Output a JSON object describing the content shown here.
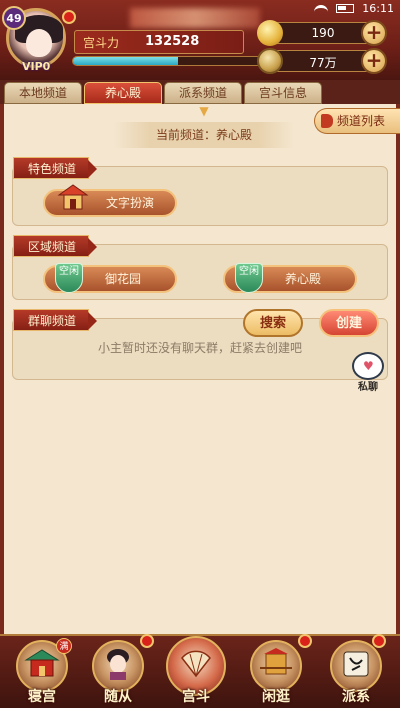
{
  "status_bar": {
    "time": "16:11"
  },
  "player": {
    "level": "49",
    "vip": "VIP0",
    "power_label": "宫斗力",
    "power_value": "132528",
    "exp_fraction": 0.56
  },
  "currencies": [
    {
      "icon": "gold-ingot-icon",
      "value": "190"
    },
    {
      "icon": "copper-coin-icon",
      "value": "77万"
    }
  ],
  "tabs": [
    {
      "label": "本地频道",
      "active": false
    },
    {
      "label": "养心殿",
      "active": true
    },
    {
      "label": "派系频道",
      "active": false
    },
    {
      "label": "宫斗信息",
      "active": false
    }
  ],
  "main": {
    "current_channel": "当前频道：养心殿",
    "channel_list_label": "频道列表",
    "featured": {
      "title": "特色频道",
      "items": [
        {
          "label": "文字扮演"
        }
      ]
    },
    "regional": {
      "title": "区域频道",
      "items": [
        {
          "status": "空闲",
          "label": "御花园"
        },
        {
          "status": "空闲",
          "label": "养心殿"
        }
      ]
    },
    "group": {
      "title": "群聊频道",
      "search_label": "搜索",
      "create_label": "创建",
      "empty_text": "小主暂时还没有聊天群，赶紧去创建吧"
    },
    "private_chat_label": "私聊"
  },
  "bottom_nav": [
    {
      "label": "寝宫",
      "badge": "满",
      "icon": "palace-icon"
    },
    {
      "label": "随从",
      "badge": "",
      "icon": "attendant-icon"
    },
    {
      "label": "宫斗",
      "badge": "",
      "icon": "fan-icon"
    },
    {
      "label": "闲逛",
      "badge": "",
      "icon": "sedan-chair-icon"
    },
    {
      "label": "派系",
      "badge": "",
      "icon": "faction-icon"
    }
  ],
  "colors": {
    "accent_red": "#a72a1a",
    "panel_bg": "#f4e6cf",
    "gold": "#e9c77a"
  }
}
